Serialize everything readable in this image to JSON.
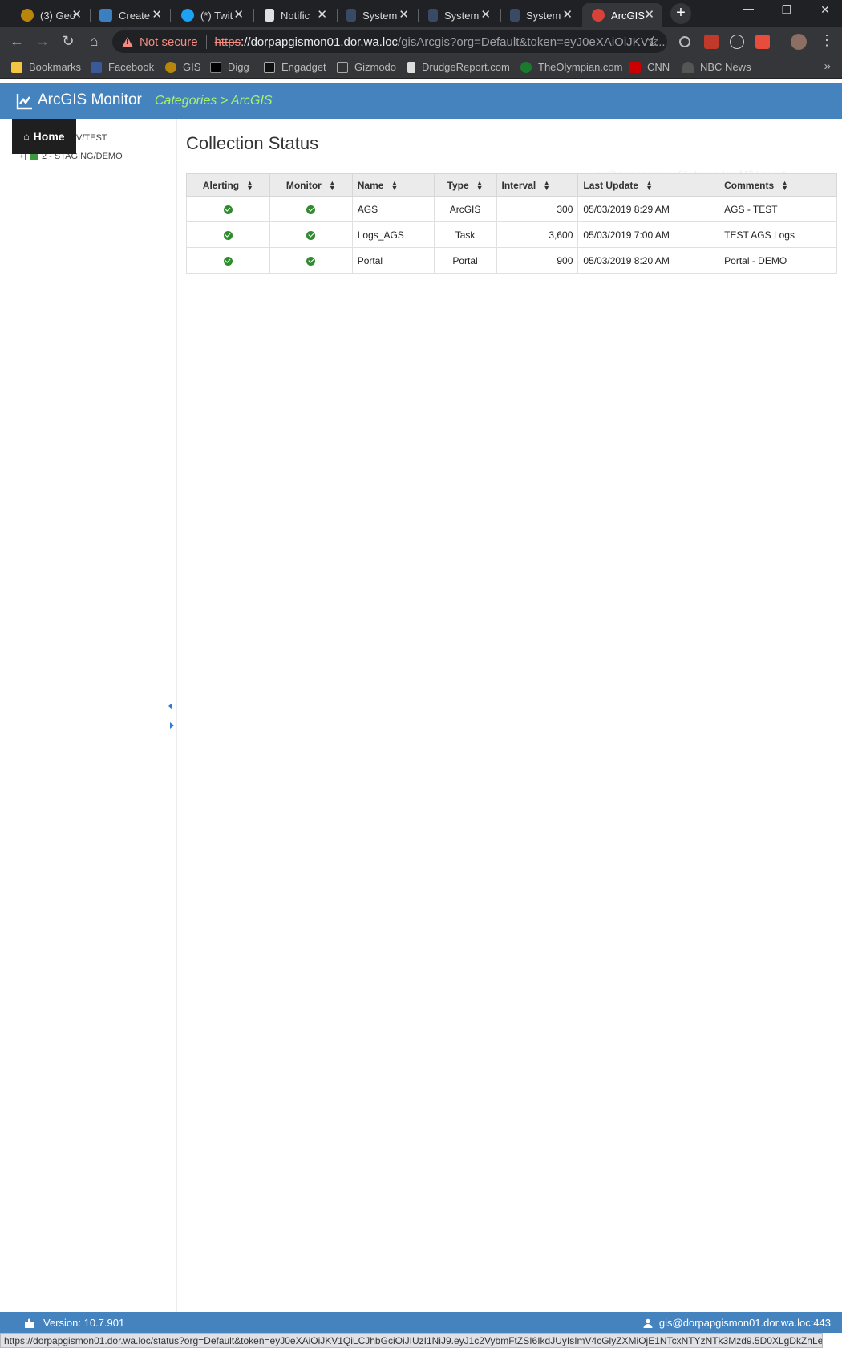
{
  "browser": {
    "tabs": [
      {
        "label": "(3) Geo",
        "favicon_color": "#b8860b"
      },
      {
        "label": "Create",
        "favicon_color": "#3a7fc0"
      },
      {
        "label": "(*) Twit",
        "favicon_color": "#1da1f2"
      },
      {
        "label": "Notific",
        "favicon_color": "#e0e0e0"
      },
      {
        "label": "System",
        "favicon_color": "#3a4a66"
      },
      {
        "label": "System",
        "favicon_color": "#3a4a66"
      },
      {
        "label": "System",
        "favicon_color": "#3a4a66"
      },
      {
        "label": "ArcGIS",
        "favicon_color": "#d9413a",
        "active": true
      }
    ],
    "omnibox": {
      "security_label": "Not secure",
      "scheme": "https",
      "host": "://dorpapgismon01.dor.wa.loc",
      "path": "/gisArcgis?org=Default&token=eyJ0eXAiOiJKV1..."
    },
    "bookmarks": [
      {
        "label": "Bookmarks",
        "color": "#f4c542"
      },
      {
        "label": "Facebook",
        "color": "#3b5998"
      },
      {
        "label": "GIS",
        "color": "#b8860b"
      },
      {
        "label": "Digg",
        "color": "#000000"
      },
      {
        "label": "Engadget",
        "color": "#111111"
      },
      {
        "label": "Gizmodo",
        "color": "#333333"
      },
      {
        "label": "DrudgeReport.com",
        "color": "#dddddd"
      },
      {
        "label": "TheOlympian.com",
        "color": "#1c7a2e"
      },
      {
        "label": "CNN",
        "color": "#cc0000"
      },
      {
        "label": "NBC News",
        "color": "#555555"
      }
    ],
    "status_url": "https://dorpapgismon01.dor.wa.loc/status?org=Default&token=eyJ0eXAiOiJKV1QiLCJhbGciOiJIUzI1NiJ9.eyJ1c2VybmFtZSI6IkdJUyIsImV4cGlyZXMiOjE1NTcxNTYzNTk3Mzd9.5D0XLgDkZhLev7Eu..."
  },
  "app": {
    "title": "ArcGIS Monitor",
    "breadcrumb": "Categories > ArcGIS",
    "header_color": "#4583be"
  },
  "sidebar": {
    "home_label": "Home",
    "tree": [
      {
        "label": "V/TEST"
      },
      {
        "label": "2 - STAGING/DEMO"
      }
    ]
  },
  "main": {
    "title": "Collection Status",
    "ghost_user": "gis@dorpapgismon01.dor.wa.loc:443 Logout",
    "columns": [
      "Alerting",
      "Monitor",
      "Name",
      "Type",
      "Interval",
      "Last Update",
      "Comments"
    ],
    "rows": [
      {
        "alerting": "ok",
        "monitor": "ok",
        "name": "AGS",
        "type": "ArcGIS",
        "interval": "300",
        "last_update": "05/03/2019 8:29 AM",
        "comments": "AGS - TEST"
      },
      {
        "alerting": "ok",
        "monitor": "ok",
        "name": "Logs_AGS",
        "type": "Task",
        "interval": "3,600",
        "last_update": "05/03/2019 7:00 AM",
        "comments": "TEST AGS Logs"
      },
      {
        "alerting": "ok",
        "monitor": "ok",
        "name": "Portal",
        "type": "Portal",
        "interval": "900",
        "last_update": "05/03/2019 8:20 AM",
        "comments": "Portal - DEMO"
      }
    ]
  },
  "footer": {
    "version": "Version: 10.7.901",
    "user": "gis@dorpapgismon01.dor.wa.loc:443"
  }
}
